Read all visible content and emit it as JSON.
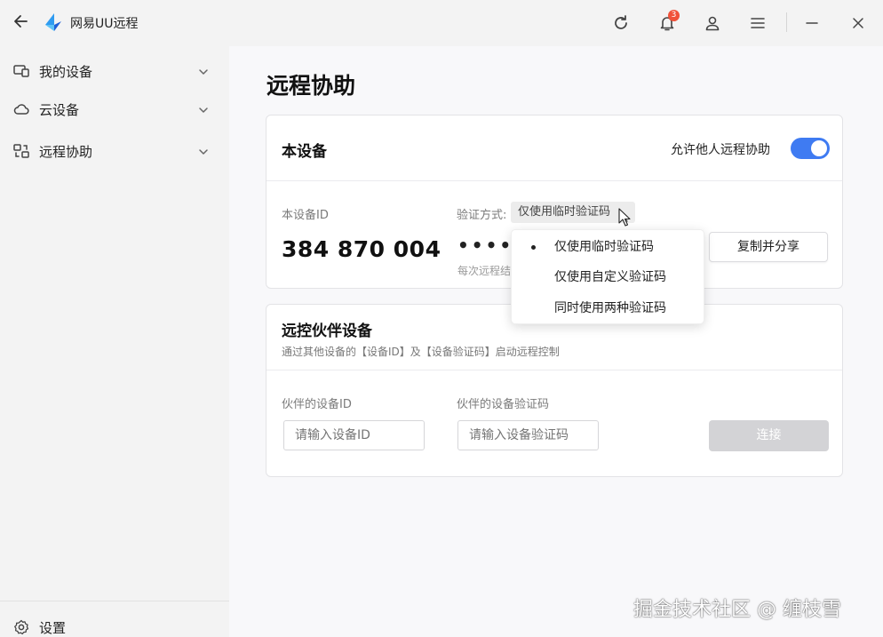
{
  "app": {
    "title": "网易UU远程",
    "notification_count": "3",
    "accent_color": "#3f7bf2"
  },
  "titlebar": {
    "icons": [
      "back-arrow-icon",
      "refresh-icon",
      "bell-icon",
      "user-icon",
      "menu-icon",
      "minimize-icon",
      "close-icon"
    ]
  },
  "sidebar": {
    "items": [
      {
        "label": "我的设备",
        "icon": "devices-icon"
      },
      {
        "label": "云设备",
        "icon": "cloud-icon"
      },
      {
        "label": "远程协助",
        "icon": "remote-assist-icon"
      }
    ],
    "settings_label": "设置"
  },
  "main": {
    "page_title": "远程协助",
    "this_device": {
      "title": "本设备",
      "allow_label": "允许他人远程协助",
      "allow_enabled": true,
      "id_label": "本设备ID",
      "id_value": "384 870 004",
      "verify_label": "验证方式:",
      "verify_selected": "仅使用临时验证码",
      "code_masked": "••••",
      "hint_truncated": "每次远程结",
      "share_button": "复制并分享"
    },
    "partner": {
      "title": "远控伙伴设备",
      "subtitle": "通过其他设备的【设备ID】及【设备验证码】启动远程控制",
      "id_label": "伙伴的设备ID",
      "id_placeholder": "请输入设备ID",
      "code_label": "伙伴的设备验证码",
      "code_placeholder": "请输入设备验证码",
      "connect_button": "连接"
    }
  },
  "dropdown": {
    "options": [
      "仅使用临时验证码",
      "仅使用自定义验证码",
      "同时使用两种验证码"
    ],
    "selected_index": 0
  },
  "watermark": "掘金技术社区 @ 缠枝雪"
}
